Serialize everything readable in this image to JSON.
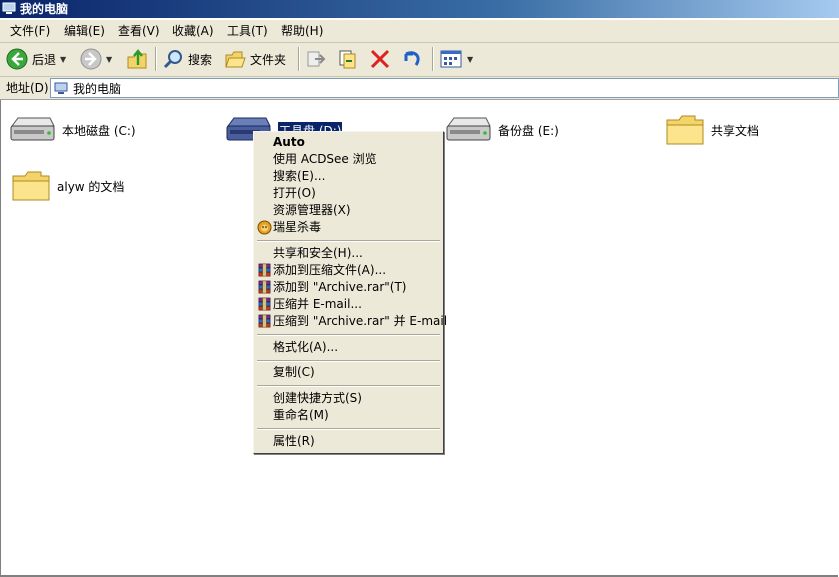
{
  "window": {
    "title": "我的电脑"
  },
  "menubar": {
    "items": [
      "文件(F)",
      "编辑(E)",
      "查看(V)",
      "收藏(A)",
      "工具(T)",
      "帮助(H)"
    ]
  },
  "toolbar": {
    "back_label": "后退",
    "search_label": "搜索",
    "folders_label": "文件夹"
  },
  "address": {
    "label": "地址(D)",
    "value": "我的电脑"
  },
  "items": [
    {
      "label": "本地磁盘 (C:)",
      "icon": "hard-drive-icon"
    },
    {
      "label": "工具盘 (D:)",
      "icon": "hard-drive-icon",
      "selected": true
    },
    {
      "label": "备份盘 (E:)",
      "icon": "hard-drive-icon"
    },
    {
      "label": "共享文档",
      "icon": "folder-icon"
    },
    {
      "label": "alyw 的文档",
      "icon": "folder-icon"
    }
  ],
  "context_menu": {
    "items": [
      {
        "label": "Auto",
        "bold": true
      },
      {
        "label": "使用 ACDSee 浏览"
      },
      {
        "label": "搜索(E)..."
      },
      {
        "label": "打开(O)"
      },
      {
        "label": "资源管理器(X)"
      },
      {
        "label": "瑞星杀毒",
        "icon": "antivirus-lion-icon"
      },
      {
        "label": "共享和安全(H)..."
      },
      {
        "label": "添加到压缩文件(A)...",
        "icon": "winrar-icon"
      },
      {
        "label": "添加到 \"Archive.rar\"(T)",
        "icon": "winrar-icon"
      },
      {
        "label": "压缩并 E-mail...",
        "icon": "winrar-icon"
      },
      {
        "label": "压缩到 \"Archive.rar\" 并 E-mail",
        "icon": "winrar-icon"
      },
      {
        "label": "格式化(A)..."
      },
      {
        "label": "复制(C)"
      },
      {
        "label": "创建快捷方式(S)"
      },
      {
        "label": "重命名(M)"
      },
      {
        "label": "属性(R)"
      }
    ]
  },
  "colors": {
    "titlebar": "#0a246a",
    "chrome": "#ece9d8",
    "selection": "#0a246a",
    "delete_red": "#e02020"
  }
}
